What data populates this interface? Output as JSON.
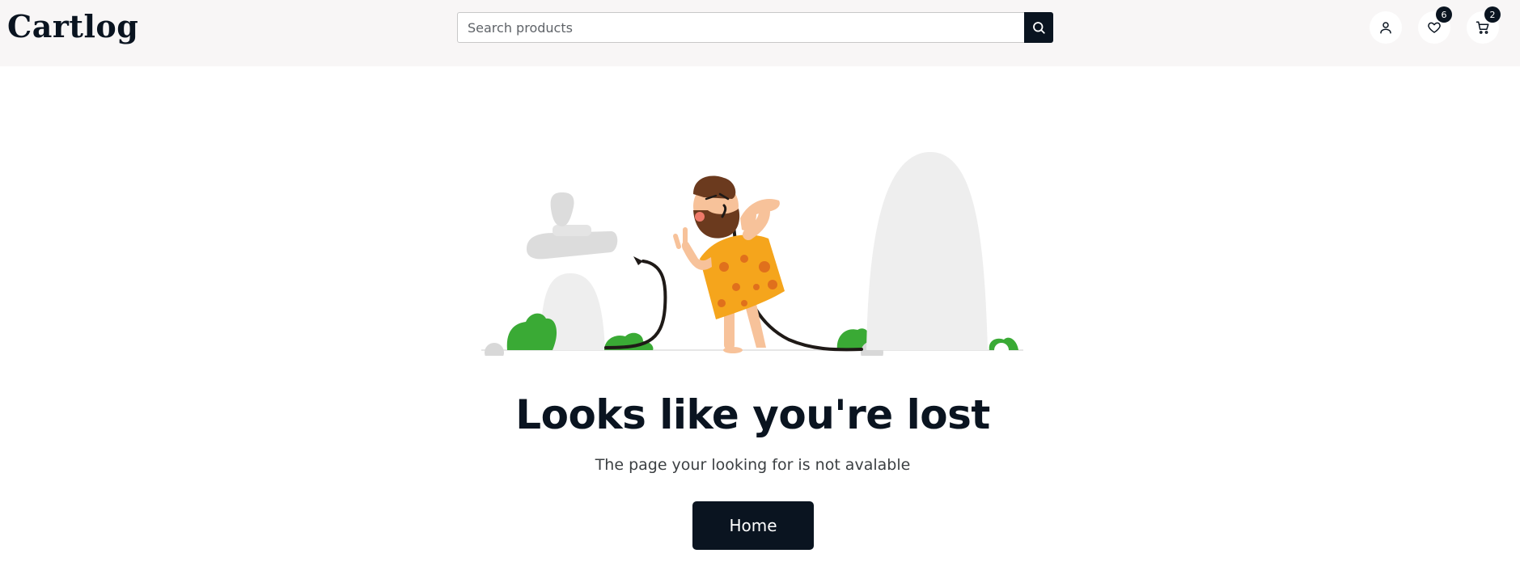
{
  "header": {
    "logo": "Cartlog",
    "search": {
      "placeholder": "Search products",
      "value": ""
    },
    "wishlist_count": "6",
    "cart_count": "2"
  },
  "icons": {
    "search": "search-icon",
    "account": "user-icon",
    "wishlist": "heart-icon",
    "cart": "cart-icon"
  },
  "main": {
    "title": "Looks like you're lost",
    "subtitle": "The page your looking for is not avalable",
    "home_button": "Home"
  },
  "colors": {
    "brand_dark": "#0a1420",
    "header_bg": "#f8f6f6",
    "rock_gray": "#eeeeee",
    "bush_green": "#3aaa35",
    "tunic_orange": "#f5a51c"
  }
}
